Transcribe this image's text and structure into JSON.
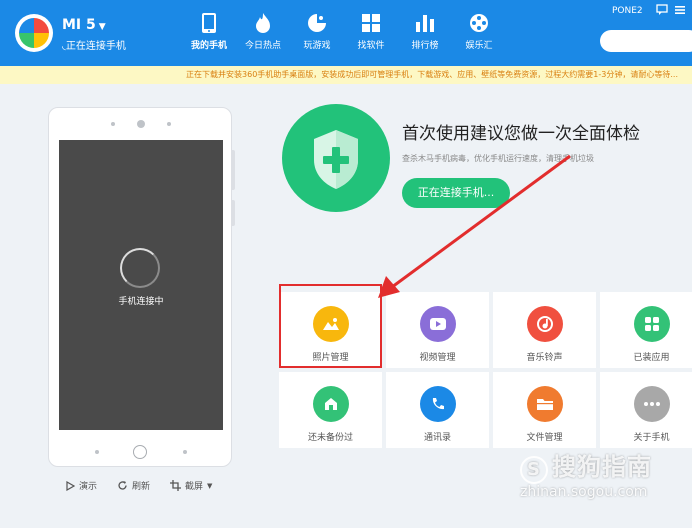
{
  "header": {
    "device_name": "MI 5",
    "device_status": "正在连接手机",
    "user": "PONE2",
    "nav": [
      {
        "label": "我的手机",
        "icon": "phone-icon",
        "active": true
      },
      {
        "label": "今日热点",
        "icon": "flame-icon",
        "active": false
      },
      {
        "label": "玩游戏",
        "icon": "game-icon",
        "active": false
      },
      {
        "label": "找软件",
        "icon": "apps-icon",
        "active": false
      },
      {
        "label": "排行榜",
        "icon": "chart-icon",
        "active": false
      },
      {
        "label": "娱乐汇",
        "icon": "film-icon",
        "active": false
      }
    ]
  },
  "notice": "正在下载并安装360手机助手桌面版，安装成功后即可管理手机，下载游戏、应用、壁纸等免费资源，过程大约需要1-3分钟，请耐心等待...",
  "phone": {
    "screen_label": "手机连接中"
  },
  "toolbar": {
    "demo": "演示",
    "refresh": "刷新",
    "screenshot": "截屏"
  },
  "hero": {
    "title": "首次使用建议您做一次全面体检",
    "subtitle": "查杀木马手机病毒，优化手机运行速度，清理手机垃圾",
    "button": "正在连接手机..."
  },
  "tiles": [
    {
      "label": "照片管理",
      "color": "#f8b70d",
      "icon": "photo-icon"
    },
    {
      "label": "视频管理",
      "color": "#8a6ed8",
      "icon": "video-icon"
    },
    {
      "label": "音乐铃声",
      "color": "#f0503f",
      "icon": "music-icon"
    },
    {
      "label": "已装应用",
      "color": "#33c277",
      "icon": "apps-grid-icon"
    },
    {
      "label": "还未备份过",
      "color": "#33c277",
      "icon": "backup-icon"
    },
    {
      "label": "通讯录",
      "color": "#1b89e6",
      "icon": "contacts-phone-icon"
    },
    {
      "label": "文件管理",
      "color": "#f07b2f",
      "icon": "folder-icon"
    },
    {
      "label": "关于手机",
      "color": "#a8a8a8",
      "icon": "more-icon"
    }
  ],
  "watermark": {
    "brand": "搜狗指南",
    "url": "zhinan.sogou.com"
  },
  "colors": {
    "header_blue": "#1b89e6",
    "accent_green": "#22c27a",
    "highlight_red": "#e22d2d"
  }
}
